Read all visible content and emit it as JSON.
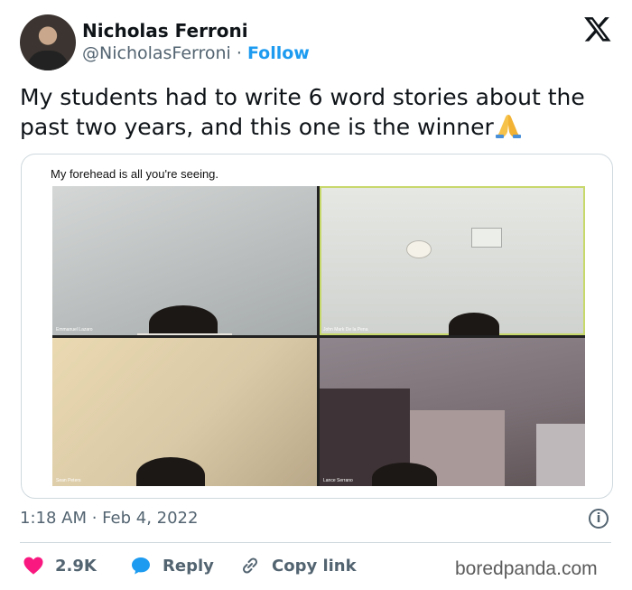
{
  "author": {
    "name": "Nicholas Ferroni",
    "handle": "@NicholasFerroni",
    "separator": "·",
    "follow_label": "Follow"
  },
  "tweet": {
    "text": "My students had to write 6 word stories about the past two years, and this one is the winner",
    "emoji": "folded-hands-icon"
  },
  "media": {
    "caption": "My forehead is all you're seeing.",
    "participants": [
      "Emmanuel Lazaro",
      "John Mark De la Pena",
      "Sean Peters",
      "Lance Serrano"
    ]
  },
  "timestamp": "1:18 AM · Feb 4, 2022",
  "actions": {
    "likes": "2.9K",
    "reply": "Reply",
    "copy_link": "Copy link"
  },
  "watermark": "boredpanda.com",
  "colors": {
    "accent": "#1d9bf0",
    "like": "#f91880",
    "muted": "#536471"
  }
}
